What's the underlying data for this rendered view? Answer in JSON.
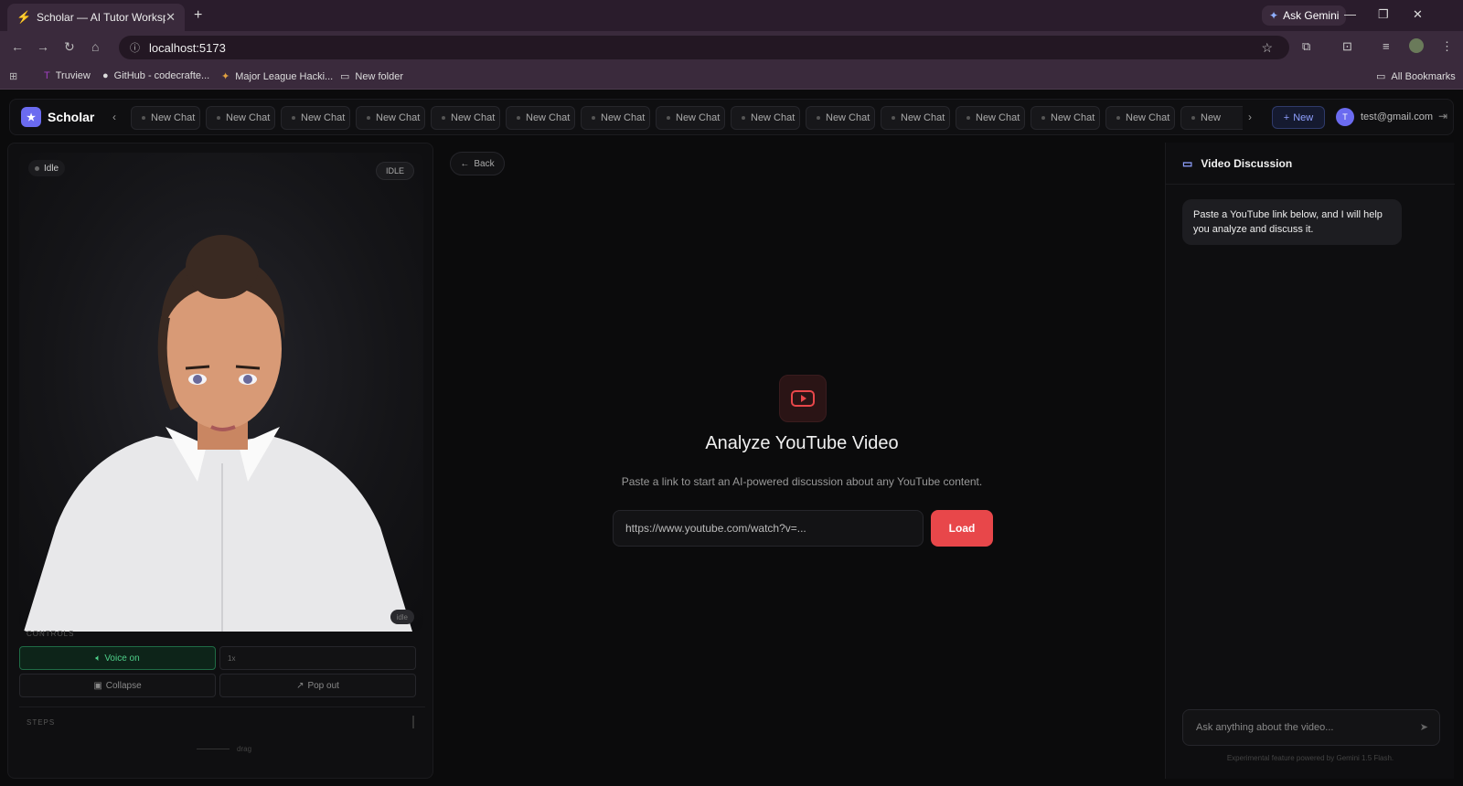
{
  "browser": {
    "tab_title": "Scholar — AI Tutor Workspace",
    "gemini_label": "Ask Gemini",
    "url": "localhost:5173",
    "bookmarks": [
      "Truview",
      "GitHub - codecrafte...",
      "Major League Hacki...",
      "New folder"
    ],
    "all_bookmarks": "All Bookmarks"
  },
  "header": {
    "brand": "Scholar",
    "chats": [
      "New Chat",
      "New Chat",
      "New Chat",
      "New Chat",
      "New Chat",
      "New Chat",
      "New Chat",
      "New Chat",
      "New Chat",
      "New Chat",
      "New Chat",
      "New Chat",
      "New Chat",
      "New Chat",
      "New"
    ],
    "new_label": "New",
    "avatar_initial": "T",
    "email": "test@gmail.com"
  },
  "avatar_panel": {
    "status_small": "Idle",
    "status_badge": "IDLE",
    "status_corner": "idle",
    "controls_label": "CONTROLS",
    "voice_label": "Voice on",
    "speed_label": "1x",
    "collapse_label": "Collapse",
    "popout_label": "Pop out",
    "steps_label": "STEPS",
    "drag_label": "drag"
  },
  "main": {
    "back_label": "Back",
    "title": "Analyze YouTube Video",
    "subtitle": "Paste a link to start an AI-powered discussion about any YouTube content.",
    "url_placeholder": "https://www.youtube.com/watch?v=...",
    "load_label": "Load"
  },
  "discussion": {
    "title": "Video Discussion",
    "message": "Paste a YouTube link below, and I will help you analyze and discuss it.",
    "input_placeholder": "Ask anything about the video...",
    "footer": "Experimental feature powered by Gemini 1.5 Flash."
  },
  "colors": {
    "accent": "#6b6bf0",
    "load_button": "#e8474a",
    "voice_on": "#4fd08a"
  }
}
